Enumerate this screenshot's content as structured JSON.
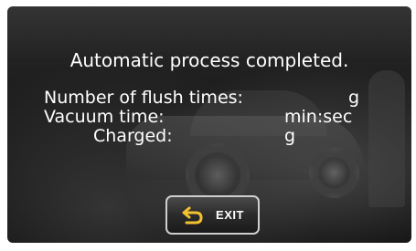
{
  "dialog": {
    "title": "Automatic process completed.",
    "rows": [
      {
        "label": "Number of flush times:",
        "unit": "g"
      },
      {
        "label": "Vacuum time:",
        "unit": "min:sec"
      },
      {
        "label": "Charged:",
        "unit": "g"
      }
    ],
    "exit_button": {
      "label": "EXIT",
      "icon": "return-arrow-icon"
    }
  },
  "colors": {
    "text": "#ffffff",
    "icon_accent": "#f2c12e",
    "button_border": "#cfcfcf"
  }
}
